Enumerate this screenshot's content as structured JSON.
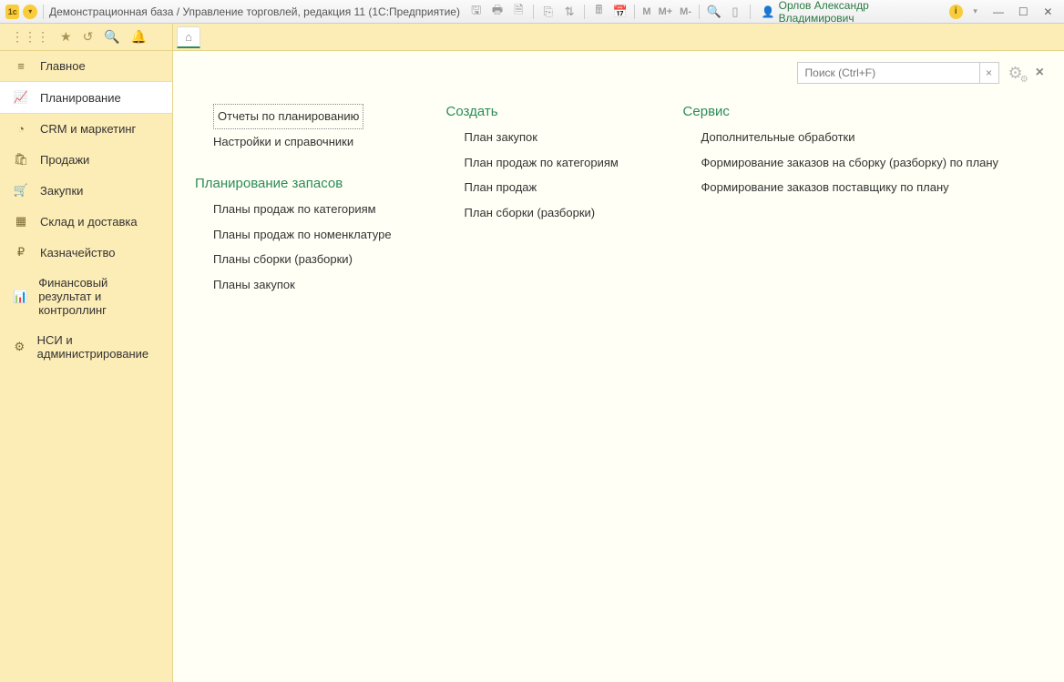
{
  "titlebar": {
    "title": "Демонстрационная база / Управление торговлей, редакция 11  (1С:Предприятие)",
    "user_name": "Орлов Александр Владимирович",
    "m_label": "M",
    "m_plus": "M+",
    "m_minus": "M-"
  },
  "sidebar": {
    "items": [
      {
        "label": "Главное",
        "icon": "menu"
      },
      {
        "label": "Планирование",
        "icon": "chart-up",
        "active": true
      },
      {
        "label": "CRM и маркетинг",
        "icon": "pie"
      },
      {
        "label": "Продажи",
        "icon": "bag"
      },
      {
        "label": "Закупки",
        "icon": "cart"
      },
      {
        "label": "Склад и доставка",
        "icon": "boxes"
      },
      {
        "label": "Казначейство",
        "icon": "ruble"
      },
      {
        "label": "Финансовый результат и контроллинг",
        "icon": "bars"
      },
      {
        "label": "НСИ и администрирование",
        "icon": "gear"
      }
    ]
  },
  "panel": {
    "search_placeholder": "Поиск (Ctrl+F)",
    "clear_label": "×"
  },
  "columns": [
    {
      "top_links": [
        {
          "label": "Отчеты по планированию",
          "boxed": true
        },
        {
          "label": "Настройки и справочники"
        }
      ],
      "groups": [
        {
          "title": "Планирование запасов",
          "links": [
            {
              "label": "Планы продаж по категориям"
            },
            {
              "label": "Планы продаж по номенклатуре"
            },
            {
              "label": "Планы сборки (разборки)"
            },
            {
              "label": "Планы закупок"
            }
          ]
        }
      ]
    },
    {
      "header": "Создать",
      "links": [
        {
          "label": "План закупок"
        },
        {
          "label": "План продаж по категориям"
        },
        {
          "label": "План продаж"
        },
        {
          "label": "План сборки (разборки)"
        }
      ]
    },
    {
      "header": "Сервис",
      "links": [
        {
          "label": "Дополнительные обработки"
        },
        {
          "label": "Формирование заказов на сборку (разборку) по плану"
        },
        {
          "label": "Формирование заказов поставщику по плану"
        }
      ]
    }
  ]
}
